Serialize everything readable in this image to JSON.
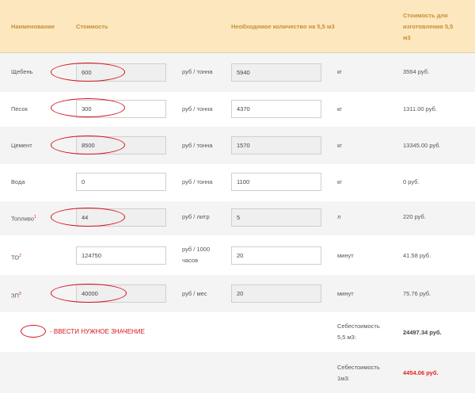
{
  "table": {
    "headers": {
      "name": "Наименование",
      "cost": "Стоимость",
      "qty": "Необходимое количество на 5,5 м3",
      "total_line1": "Стоимость для",
      "total_line2": "изготовления 5,5",
      "total_line3": "м3"
    },
    "rows": [
      {
        "name": "Щебень",
        "sup": "",
        "price": "600",
        "unit_price": "руб / тонна",
        "unit_price2": "",
        "qty": "5940",
        "unit_qty": "кг",
        "total": "3564 руб."
      },
      {
        "name": "Песок",
        "sup": "",
        "price": "300",
        "unit_price": "руб / тонна",
        "unit_price2": "",
        "qty": "4370",
        "unit_qty": "кг",
        "total": "1311.00 руб."
      },
      {
        "name": "Цемент",
        "sup": "",
        "price": "8500",
        "unit_price": "руб / тонна",
        "unit_price2": "",
        "qty": "1570",
        "unit_qty": "кг",
        "total": "13345.00 руб."
      },
      {
        "name": "Вода",
        "sup": "",
        "price": "0",
        "unit_price": "руб / тонна",
        "unit_price2": "",
        "qty": "1100",
        "unit_qty": "кг",
        "total": "0 руб."
      },
      {
        "name": "Топливо",
        "sup": "1",
        "price": "44",
        "unit_price": "руб / литр",
        "unit_price2": "",
        "qty": "5",
        "unit_qty": "л",
        "total": "220 руб."
      },
      {
        "name": "ТО",
        "sup": "2",
        "price": "124750",
        "unit_price": "руб / 1000",
        "unit_price2": "часов",
        "qty": "20",
        "unit_qty": "минут",
        "total": "41.58 руб."
      },
      {
        "name": "ЗП",
        "sup": "3",
        "price": "40000",
        "unit_price": "руб / мес",
        "unit_price2": "",
        "qty": "20",
        "unit_qty": "минут",
        "total": "75.76 руб."
      }
    ]
  },
  "legend": {
    "text": "- ВВЕСТИ НУЖНОЕ ЗНАЧЕНИЕ"
  },
  "summary": {
    "cost_label_line1": "Себестоимость",
    "cost_label_line2": "5,5 м3:",
    "cost_value": "24497.34 руб.",
    "unit_label_line1": "Себестоимость",
    "unit_label_line2": "1м3:",
    "unit_value": "4454.06 руб."
  },
  "colors": {
    "accent_header": "#c69032",
    "header_bg": "#fce7bf",
    "annotation_red": "#d4141f"
  }
}
